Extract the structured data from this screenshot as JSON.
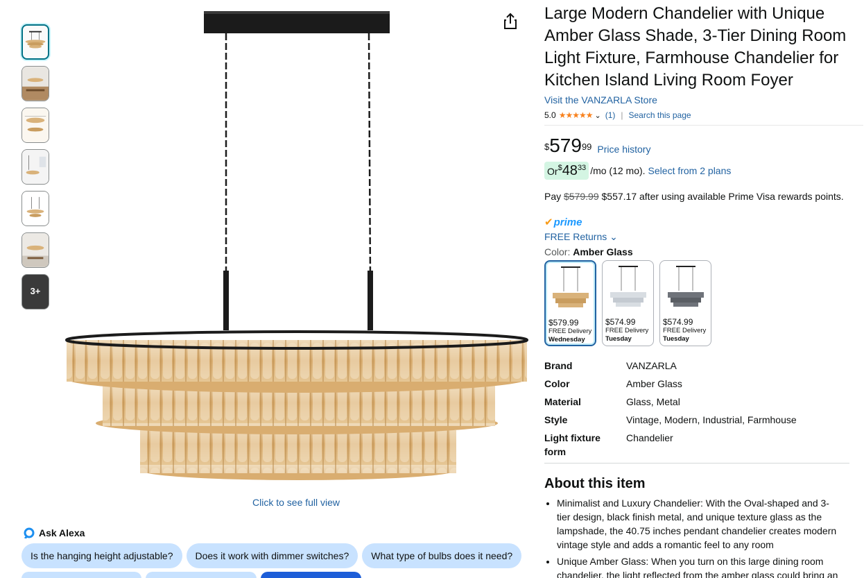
{
  "product": {
    "title": "Large Modern Chandelier with Unique Amber Glass Shade, 3-Tier Dining Room Light Fixture, Farmhouse Chandelier for Kitchen Island Living Room Foyer",
    "store_link": "Visit the VANZARLA Store",
    "rating": "5.0",
    "stars": "★★★★★",
    "rating_count": "(1)",
    "search_page": "Search this page",
    "price_symbol": "$",
    "price_whole": "579",
    "price_fraction": "99",
    "price_history": "Price history",
    "monthly": {
      "prefix": "Or ",
      "symbol": "$",
      "whole": "48",
      "fraction": "33",
      "suffix": "/mo (12 mo).",
      "plans_link": "Select from 2 plans"
    },
    "pay": {
      "prefix": "Pay ",
      "original": "$579.99",
      "rest": " $557.17 after using available Prime Visa rewards points."
    },
    "prime_label": "prime",
    "free_returns": "FREE Returns",
    "color_label": "Color: ",
    "color_value": "Amber Glass",
    "swatches": [
      {
        "price": "$579.99",
        "delivery": "FREE Delivery",
        "day": "Wednesday",
        "glass_color": "#d9b27a"
      },
      {
        "price": "$574.99",
        "delivery": "FREE Delivery",
        "day": "Tuesday",
        "glass_color": "#d8dde2"
      },
      {
        "price": "$574.99",
        "delivery": "FREE Delivery",
        "day": "Tuesday",
        "glass_color": "#6f737a"
      }
    ],
    "specs": [
      {
        "key": "Brand",
        "value": "VANZARLA"
      },
      {
        "key": "Color",
        "value": "Amber Glass"
      },
      {
        "key": "Material",
        "value": "Glass, Metal"
      },
      {
        "key": "Style",
        "value": "Vintage, Modern, Industrial, Farmhouse"
      },
      {
        "key": "Light fixture form",
        "value": "Chandelier"
      }
    ],
    "about_title": "About this item",
    "bullets": [
      "Minimalist and Luxury Chandelier: With the Oval-shaped and 3-tier design, black finish metal, and unique texture glass as the lampshade, the 40.75 inches pendant chandelier creates modern vintage style and adds a romantic feel to any room",
      "Unique Amber Glass: When you turn on this large dining room chandelier, the light reflected from the amber glass could bring an"
    ]
  },
  "gallery": {
    "more_label": "3+",
    "full_view": "Click to see full view"
  },
  "alexa": {
    "label": "Ask Alexa",
    "chips": [
      "Is the hanging height adjustable?",
      "Does it work with dimmer switches?",
      "What type of bulbs does it need?"
    ]
  },
  "colors": {
    "link": "#2162a1",
    "star": "#f8821e",
    "chip_bg": "#c8e2ff",
    "amber": "#d9b27a"
  }
}
